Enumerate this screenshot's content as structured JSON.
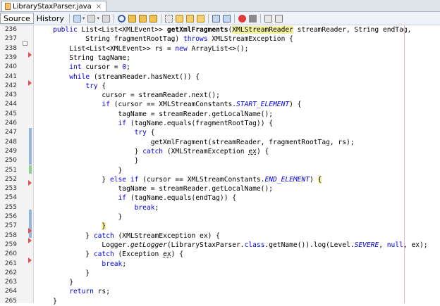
{
  "tab": {
    "filename": "LibraryStaxParser.java",
    "close": "×"
  },
  "toolbar": {
    "source_label": "Source",
    "history_label": "History",
    "icons": [
      "last-edit-icon",
      "back-icon",
      "forward-icon",
      "find-icon",
      "find-prev-icon",
      "find-next-icon",
      "toggle-highlight-icon",
      "toggle-rect-selection-icon",
      "prev-bookmark-icon",
      "next-bookmark-icon",
      "toggle-bookmark-icon",
      "shift-left-icon",
      "shift-right-icon",
      "record-macro-icon",
      "stop-macro-icon",
      "comment-icon",
      "uncomment-icon"
    ],
    "colors": {
      "record": "#e03a3a",
      "stop": "#8a8a8a"
    }
  },
  "editor": {
    "current_line": 257,
    "lines": [
      {
        "n": "236",
        "tokens": [
          [
            "    ",
            ""
          ],
          [
            "public ",
            "kw"
          ],
          [
            "List<List<XMLEvent>> ",
            ""
          ],
          [
            "getXmlFragments",
            "bold"
          ],
          [
            "(",
            ""
          ],
          [
            "XMLStreamReader",
            "hl"
          ],
          [
            " streamReader, String endTag,",
            ""
          ]
        ]
      },
      {
        "n": "237",
        "tokens": [
          [
            "            String fragmentRootTag) ",
            ""
          ],
          [
            "throws ",
            "kw"
          ],
          [
            "XMLStreamException {",
            ""
          ]
        ]
      },
      {
        "n": "238",
        "tokens": [
          [
            "        List<List<XMLEvent>> rs = ",
            ""
          ],
          [
            "new ",
            "kw"
          ],
          [
            "ArrayList<>();",
            ""
          ]
        ]
      },
      {
        "n": "239",
        "tokens": [
          [
            "        String tagName;",
            ""
          ]
        ]
      },
      {
        "n": "240",
        "tokens": [
          [
            "        ",
            ""
          ],
          [
            "int ",
            "kw"
          ],
          [
            "cursor = ",
            ""
          ],
          [
            "0",
            "kw"
          ],
          [
            ";",
            ""
          ]
        ]
      },
      {
        "n": "241",
        "tokens": [
          [
            "        ",
            ""
          ],
          [
            "while ",
            "kw"
          ],
          [
            "(streamReader.hasNext()) {",
            ""
          ]
        ]
      },
      {
        "n": "242",
        "tokens": [
          [
            "            ",
            ""
          ],
          [
            "try ",
            "kw"
          ],
          [
            "{",
            ""
          ]
        ]
      },
      {
        "n": "243",
        "tokens": [
          [
            "                cursor = streamReader.next();",
            ""
          ]
        ]
      },
      {
        "n": "244",
        "tokens": [
          [
            "                ",
            ""
          ],
          [
            "if ",
            "kw"
          ],
          [
            "(cursor == XMLStreamConstants.",
            ""
          ],
          [
            "START_ELEMENT",
            "italic"
          ],
          [
            ") {",
            ""
          ]
        ]
      },
      {
        "n": "245",
        "tokens": [
          [
            "                    tagName = streamReader.getLocalName();",
            ""
          ]
        ]
      },
      {
        "n": "246",
        "tokens": [
          [
            "                    ",
            ""
          ],
          [
            "if ",
            "kw"
          ],
          [
            "(tagName.equals(fragmentRootTag)) {",
            ""
          ]
        ]
      },
      {
        "n": "247",
        "tokens": [
          [
            "                        ",
            ""
          ],
          [
            "try ",
            "kw"
          ],
          [
            "{",
            ""
          ]
        ]
      },
      {
        "n": "248",
        "tokens": [
          [
            "                            getXmlFragment(streamReader, fragmentRootTag, rs);",
            ""
          ]
        ]
      },
      {
        "n": "249",
        "tokens": [
          [
            "                        } ",
            ""
          ],
          [
            "catch ",
            "kw"
          ],
          [
            "(XMLStreamException ",
            ""
          ],
          [
            "ex",
            "u"
          ],
          [
            ") {",
            ""
          ]
        ]
      },
      {
        "n": "250",
        "tokens": [
          [
            "                        }",
            ""
          ]
        ]
      },
      {
        "n": "251",
        "tokens": [
          [
            "                    }",
            ""
          ]
        ]
      },
      {
        "n": "252",
        "tokens": [
          [
            "                } ",
            ""
          ],
          [
            "else if ",
            "kw"
          ],
          [
            "(cursor == XMLStreamConstants.",
            ""
          ],
          [
            "END_ELEMENT",
            "italic"
          ],
          [
            ") ",
            ""
          ],
          [
            "{",
            "hl"
          ]
        ]
      },
      {
        "n": "253",
        "tokens": [
          [
            "                    tagName = streamReader.getLocalName();",
            ""
          ]
        ]
      },
      {
        "n": "254",
        "tokens": [
          [
            "                    ",
            ""
          ],
          [
            "if ",
            "kw"
          ],
          [
            "(tagName.equals(endTag)) {",
            ""
          ]
        ]
      },
      {
        "n": "255",
        "tokens": [
          [
            "                        ",
            ""
          ],
          [
            "break",
            "kw"
          ],
          [
            ";",
            ""
          ]
        ]
      },
      {
        "n": "256",
        "tokens": [
          [
            "                    }",
            ""
          ]
        ]
      },
      {
        "n": "257",
        "tokens": [
          [
            "                ",
            ""
          ],
          [
            "}",
            "hl"
          ]
        ]
      },
      {
        "n": "258",
        "tokens": [
          [
            "            } ",
            ""
          ],
          [
            "catch ",
            "kw"
          ],
          [
            "(XMLStreamException ex) {",
            ""
          ]
        ]
      },
      {
        "n": "259",
        "tokens": [
          [
            "                Logger.",
            ""
          ],
          [
            "getLogger",
            "i2"
          ],
          [
            "(LibraryStaxParser.",
            ""
          ],
          [
            "class",
            "kw"
          ],
          [
            ".getName()).log(Level.",
            ""
          ],
          [
            "SEVERE",
            "italic"
          ],
          [
            ", ",
            ""
          ],
          [
            "null",
            "kw"
          ],
          [
            ", ex);",
            ""
          ]
        ]
      },
      {
        "n": "260",
        "tokens": [
          [
            "            } ",
            ""
          ],
          [
            "catch ",
            "kw"
          ],
          [
            "(Exception ",
            ""
          ],
          [
            "ex",
            "u"
          ],
          [
            ") {",
            ""
          ]
        ]
      },
      {
        "n": "261",
        "tokens": [
          [
            "                ",
            ""
          ],
          [
            "break",
            "kw"
          ],
          [
            ";",
            ""
          ]
        ]
      },
      {
        "n": "262",
        "tokens": [
          [
            "            }",
            ""
          ]
        ]
      },
      {
        "n": "263",
        "tokens": [
          [
            "        }",
            ""
          ]
        ]
      },
      {
        "n": "264",
        "tokens": [
          [
            "        ",
            ""
          ],
          [
            "return ",
            "kw"
          ],
          [
            "rs;",
            ""
          ]
        ]
      },
      {
        "n": "265",
        "tokens": [
          [
            "    }",
            ""
          ]
        ]
      }
    ]
  }
}
